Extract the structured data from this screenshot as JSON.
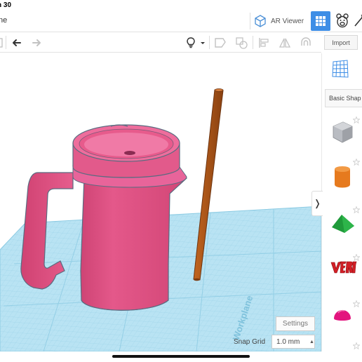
{
  "status_bar": {
    "time": "n 30"
  },
  "header": {
    "title": "ne",
    "ar_viewer_label": "AR Viewer"
  },
  "toolbar": {
    "import_label": "Import"
  },
  "panel": {
    "category_label": "Basic Shap",
    "shapes": [
      "box-shape-icon",
      "cylinder-shape-icon",
      "roof-shape-icon",
      "text-shape-icon",
      "half-sphere-shape-icon"
    ]
  },
  "workplane": {
    "label": "Workplane"
  },
  "footer": {
    "settings_label": "Settings",
    "snap_grid_label": "Snap Grid",
    "snap_grid_value": "1.0 mm"
  },
  "colors": {
    "accent": "#3e8ee6",
    "workplane": "#b9e3f3",
    "mug": "#e6588a",
    "straw": "#a8521a"
  }
}
